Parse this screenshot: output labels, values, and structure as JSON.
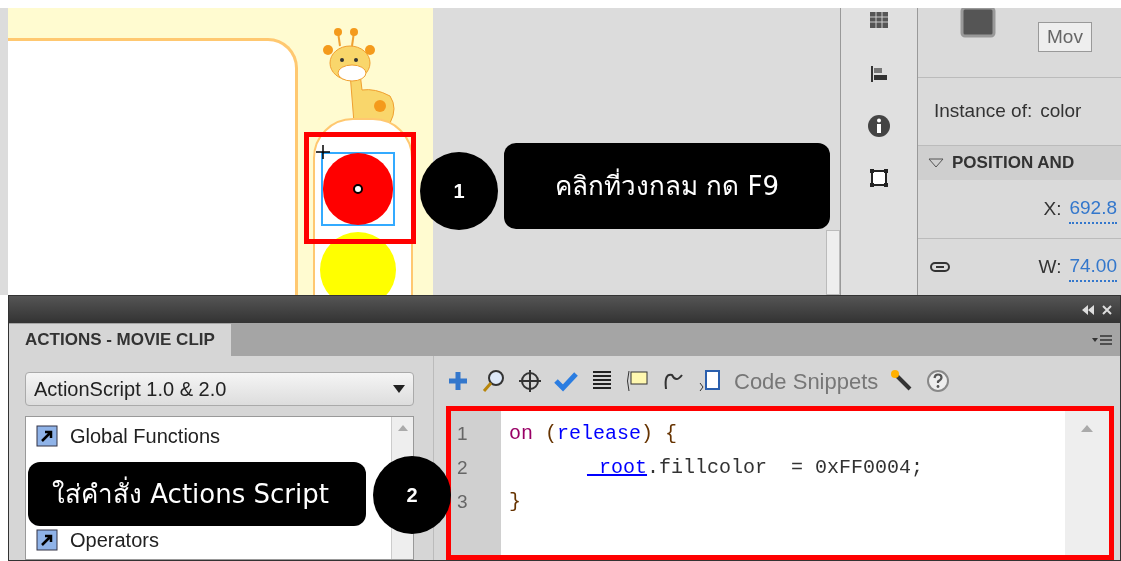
{
  "properties": {
    "button": "Mov",
    "instance_label": "Instance of:",
    "instance_value": "color",
    "section": {
      "title": "POSITION AND",
      "expanded": true
    },
    "fields": [
      {
        "label": "X:",
        "value": "692.8"
      },
      {
        "label": "W:",
        "value": "74.00"
      }
    ]
  },
  "actions_panel": {
    "tab": {
      "label": "ACTIONS - MOVIE CLIP",
      "selected": true
    },
    "language": "ActionScript 1.0 & 2.0",
    "library": [
      {
        "label": "Global Functions"
      },
      {
        "label": "Operators"
      }
    ],
    "toolbar": {
      "snippets": "Code Snippets"
    },
    "code": [
      {
        "number": "1",
        "indent": false,
        "tokens": [
          {
            "text": "on",
            "kind": "keyword"
          },
          {
            "text": " (",
            "kind": "punct"
          },
          {
            "text": "release",
            "kind": "event"
          },
          {
            "text": ")",
            "kind": "punct"
          },
          {
            "text": " {",
            "kind": "punct"
          }
        ]
      },
      {
        "number": "2",
        "indent": true,
        "tokens": [
          {
            "text": "_root",
            "kind": "global"
          },
          {
            "text": ".fillcolor  = 0xFF0004;",
            "kind": "plain"
          }
        ]
      },
      {
        "number": "3",
        "indent": false,
        "tokens": [
          {
            "text": "}",
            "kind": "punct"
          }
        ]
      }
    ]
  },
  "callouts": [
    {
      "number": "1",
      "text": "คลิกที่วงกลม กด F9"
    },
    {
      "number": "2",
      "text": "ใส่คำสั่ง Actions Script"
    }
  ]
}
